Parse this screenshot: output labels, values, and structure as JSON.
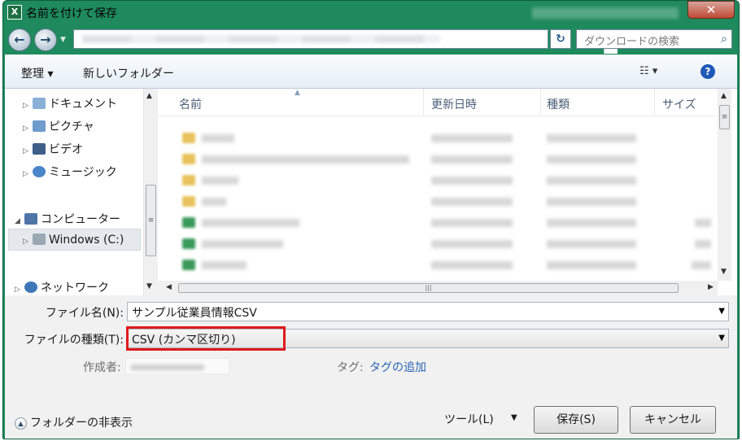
{
  "window": {
    "title": "名前を付けて保存",
    "app_icon_text": "X"
  },
  "address_bar": {
    "search_placeholder": "ダウンロードの検索"
  },
  "toolbar": {
    "organize_label": "整理 ▾",
    "new_folder_label": "新しいフォルダー"
  },
  "nav": {
    "items": [
      {
        "label": "ドキュメント",
        "icon": "documents-icon",
        "expander": "▷"
      },
      {
        "label": "ピクチャ",
        "icon": "pictures-icon",
        "expander": "▷"
      },
      {
        "label": "ビデオ",
        "icon": "videos-icon",
        "expander": "▷"
      },
      {
        "label": "ミュージック",
        "icon": "music-icon",
        "expander": "▷"
      },
      {
        "label": "コンピューター",
        "icon": "computer-icon",
        "expander": "◢"
      },
      {
        "label": "Windows (C:)",
        "icon": "drive-icon",
        "expander": "▷"
      },
      {
        "label": "ネットワーク",
        "icon": "network-icon",
        "expander": "▷"
      }
    ]
  },
  "columns": {
    "name": "名前",
    "date": "更新日時",
    "type": "種類",
    "size": "サイズ"
  },
  "form": {
    "filename_label": "ファイル名(N):",
    "filename_value": "サンプル従業員情報CSV",
    "filetype_label": "ファイルの種類(T):",
    "filetype_value": "CSV (カンマ区切り)",
    "author_label": "作成者:",
    "tag_label": "タグ:",
    "tag_link": "タグの追加"
  },
  "footer": {
    "hide_folders_label": "フォルダーの非表示",
    "tools_label": "ツール(L)",
    "save_label": "保存(S)",
    "cancel_label": "キャンセル"
  },
  "colors": {
    "titlebar": "#1f8a5e",
    "highlight_box": "#e0191c",
    "link": "#2462b4",
    "folder_icon": "#e8c25a",
    "excel_icon": "#3a9a5c"
  }
}
